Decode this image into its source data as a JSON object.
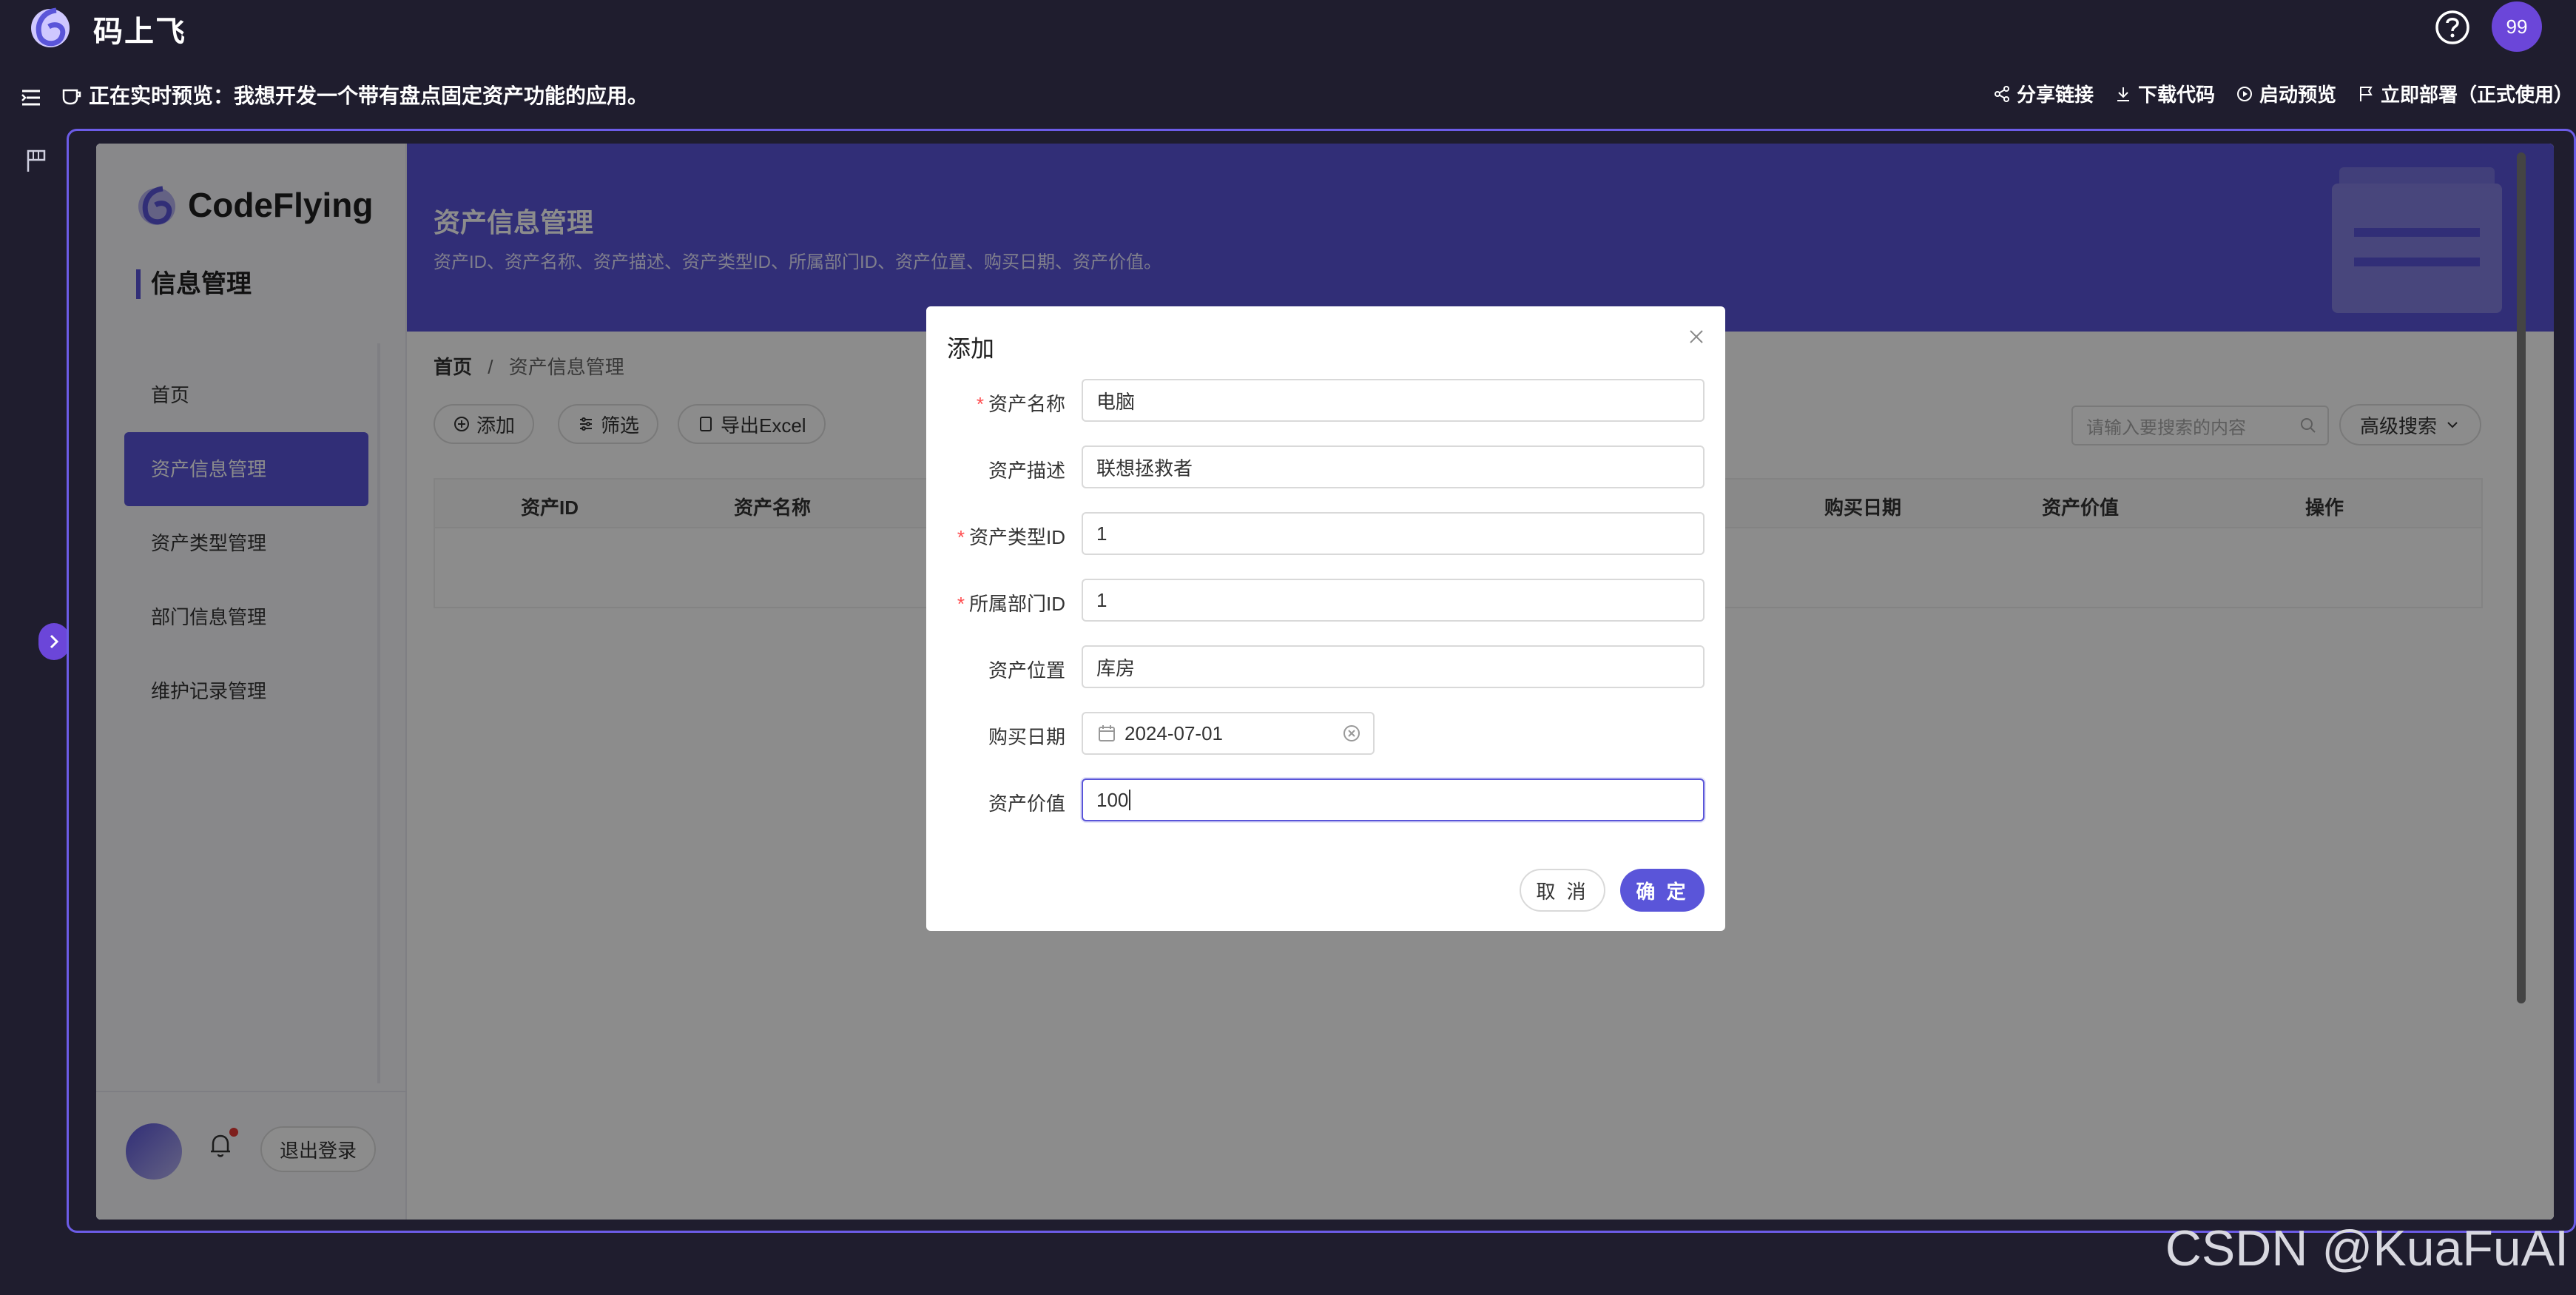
{
  "app": {
    "title": "码上飞",
    "avatar_text": "99"
  },
  "preview_bar": {
    "text": "正在实时预览：我想开发一个带有盘点固定资产功能的应用。",
    "actions": [
      "分享链接",
      "下载代码",
      "启动预览",
      "立即部署（正式使用）"
    ]
  },
  "inner_app": {
    "brand": "CodeFlying",
    "section": "信息管理",
    "nav": [
      {
        "label": "首页",
        "active": false
      },
      {
        "label": "资产信息管理",
        "active": true
      },
      {
        "label": "资产类型管理",
        "active": false
      },
      {
        "label": "部门信息管理",
        "active": false
      },
      {
        "label": "维护记录管理",
        "active": false
      }
    ],
    "logout": "退出登录",
    "header": {
      "title": "资产信息管理",
      "desc": "资产ID、资产名称、资产描述、资产类型ID、所属部门ID、资产位置、购买日期、资产价值。"
    },
    "breadcrumb": {
      "root": "首页",
      "sep": "/",
      "current": "资产信息管理"
    },
    "toolbar": {
      "add": "添加",
      "filter": "筛选",
      "export": "导出Excel"
    },
    "search": {
      "placeholder": "请输入要搜索的内容",
      "advanced": "高级搜索"
    },
    "table": {
      "columns": [
        "资产ID",
        "资产名称",
        "购买日期",
        "资产价值",
        "操作"
      ]
    }
  },
  "modal": {
    "title": "添加",
    "fields": [
      {
        "label": "资产名称",
        "required": true,
        "value": "电脑"
      },
      {
        "label": "资产描述",
        "required": false,
        "value": "联想拯救者"
      },
      {
        "label": "资产类型ID",
        "required": true,
        "value": "1"
      },
      {
        "label": "所属部门ID",
        "required": true,
        "value": "1"
      },
      {
        "label": "资产位置",
        "required": false,
        "value": "库房"
      },
      {
        "label": "购买日期",
        "required": false,
        "value": "2024-07-01"
      },
      {
        "label": "资产价值",
        "required": false,
        "value": "100"
      }
    ],
    "cancel": "取 消",
    "ok": "确 定"
  },
  "watermark": "CSDN @KuaFuAI",
  "colors": {
    "accent": "#5a55d9",
    "bg_dark": "#1f1d2e",
    "required": "#ff4d4f"
  }
}
